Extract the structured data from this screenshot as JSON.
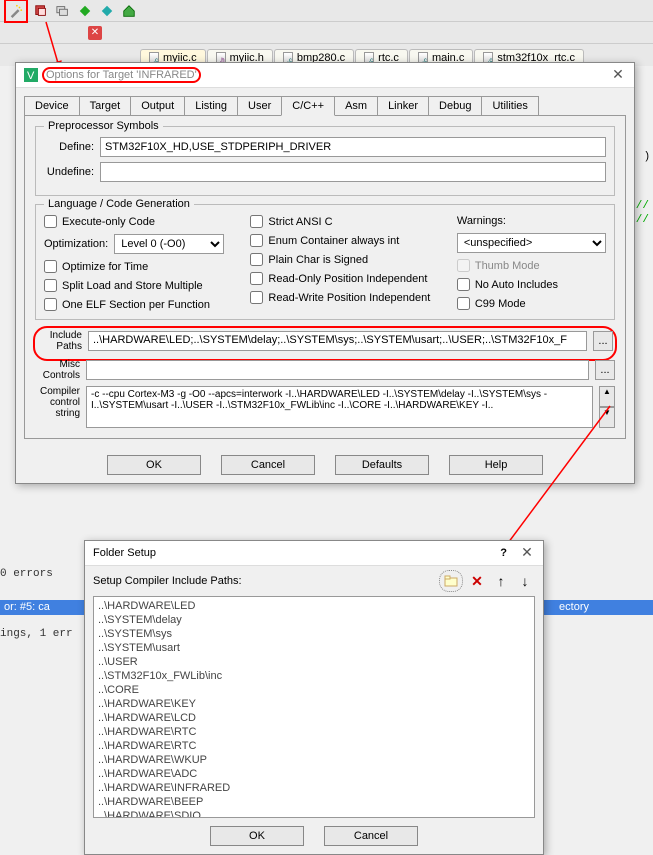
{
  "toolbar_icons": [
    "wand",
    "target",
    "layers",
    "diamond-green",
    "diamond-teal",
    "home"
  ],
  "file_tabs": [
    {
      "label": "myiic.c",
      "type": "c",
      "active": true
    },
    {
      "label": "myiic.h",
      "type": "h",
      "active": false
    },
    {
      "label": "bmp280.c",
      "type": "c",
      "active": false
    },
    {
      "label": "rtc.c",
      "type": "c",
      "active": false
    },
    {
      "label": "main.c",
      "type": "c",
      "active": false
    },
    {
      "label": "stm32f10x_rtc.c",
      "type": "c",
      "active": false
    }
  ],
  "options_dialog": {
    "title": "Options for Target 'INFRARED'",
    "tabs": [
      "Device",
      "Target",
      "Output",
      "Listing",
      "User",
      "C/C++",
      "Asm",
      "Linker",
      "Debug",
      "Utilities"
    ],
    "active_tab": "C/C++",
    "preprocessor": {
      "group": "Preprocessor Symbols",
      "define_label": "Define:",
      "define_value": "STM32F10X_HD,USE_STDPERIPH_DRIVER",
      "undefine_label": "Undefine:",
      "undefine_value": ""
    },
    "lang": {
      "group": "Language / Code Generation",
      "execute_only": "Execute-only Code",
      "optimization_label": "Optimization:",
      "optimization_value": "Level 0 (-O0)",
      "optimize_time": "Optimize for Time",
      "split_load": "Split Load and Store Multiple",
      "one_elf": "One ELF Section per Function",
      "strict_ansi": "Strict ANSI C",
      "enum_container": "Enum Container always int",
      "plain_char": "Plain Char is Signed",
      "readonly_pos": "Read-Only Position Independent",
      "readwrite_pos": "Read-Write Position Independent",
      "warnings_label": "Warnings:",
      "warnings_value": "<unspecified>",
      "thumb_mode": "Thumb Mode",
      "no_auto": "No Auto Includes",
      "c99": "C99 Mode"
    },
    "include": {
      "label": "Include\nPaths",
      "value": "..\\HARDWARE\\LED;..\\SYSTEM\\delay;..\\SYSTEM\\sys;..\\SYSTEM\\usart;..\\USER;..\\STM32F10x_F"
    },
    "misc": {
      "label": "Misc\nControls",
      "value": ""
    },
    "compiler": {
      "label": "Compiler\ncontrol\nstring",
      "value": "-c --cpu Cortex-M3 -g -O0 --apcs=interwork -I..\\HARDWARE\\LED -I..\\SYSTEM\\delay -I..\\SYSTEM\\sys -I..\\SYSTEM\\usart -I..\\USER -I..\\STM32F10x_FWLib\\inc -I..\\CORE -I..\\HARDWARE\\KEY -I.."
    },
    "buttons": {
      "ok": "OK",
      "cancel": "Cancel",
      "defaults": "Defaults",
      "help": "Help"
    }
  },
  "folder_dialog": {
    "title": "Folder Setup",
    "subtitle": "Setup Compiler Include Paths:",
    "items": [
      "..\\HARDWARE\\LED",
      "..\\SYSTEM\\delay",
      "..\\SYSTEM\\sys",
      "..\\SYSTEM\\usart",
      "..\\USER",
      "..\\STM32F10x_FWLib\\inc",
      "..\\CORE",
      "..\\HARDWARE\\KEY",
      "..\\HARDWARE\\LCD",
      "..\\HARDWARE\\RTC",
      "..\\HARDWARE\\RTC",
      "..\\HARDWARE\\WKUP",
      "..\\HARDWARE\\ADC",
      "..\\HARDWARE\\INFRARED",
      "..\\HARDWARE\\BEEP",
      "..\\HARDWARE\\SDIO"
    ],
    "buttons": {
      "ok": "OK",
      "cancel": "Cancel"
    }
  },
  "background": {
    "errors": "0 errors",
    "error_line": "or:  #5: ca",
    "error_tail": "ectory",
    "warnings": "ings, 1 err"
  }
}
